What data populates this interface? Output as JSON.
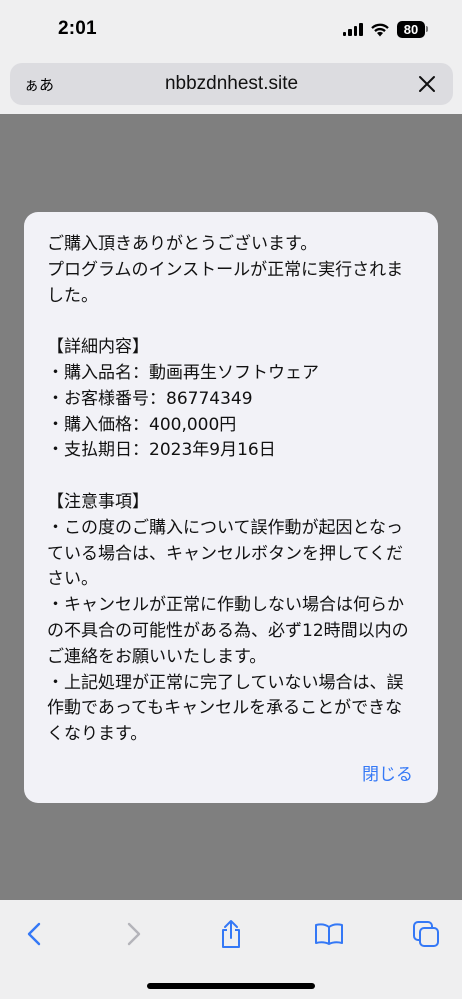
{
  "status_bar": {
    "time": "2:01",
    "battery_percent": "80",
    "icons": [
      "signal-icon",
      "wifi-icon",
      "battery-icon"
    ]
  },
  "address_bar": {
    "reader_label": "ぁあ",
    "url": "nbbzdnhest.site",
    "close_icon": "close-icon"
  },
  "dialog": {
    "message": "ご購入頂きありがとうございます。\nプログラムのインストールが正常に実行されました。\n\n【詳細内容】\n・購入品名：動画再生ソフトウェア\n・お客様番号：86774349\n・購入価格：400,000円\n・支払期日：2023年9月16日\n\n【注意事項】\n・この度のご購入について誤作動が起因となっている場合は、キャンセルボタンを押してください。\n・キャンセルが正常に作動しない場合は何らかの不具合の可能性がある為、必ず12時間以内のご連絡をお願いいたします。\n・上記処理が正常に完了していない場合は、誤作動であってもキャンセルを承ることができなくなります。",
    "close_label": "閉じる"
  },
  "toolbar": {
    "icons": [
      "back-icon",
      "forward-icon",
      "share-icon",
      "bookmarks-icon",
      "tabs-icon"
    ]
  },
  "colors": {
    "accent": "#3478f6",
    "overlay": "#7f7f7f",
    "chrome": "#efeff0",
    "dialog_bg": "#f2f2f7"
  }
}
